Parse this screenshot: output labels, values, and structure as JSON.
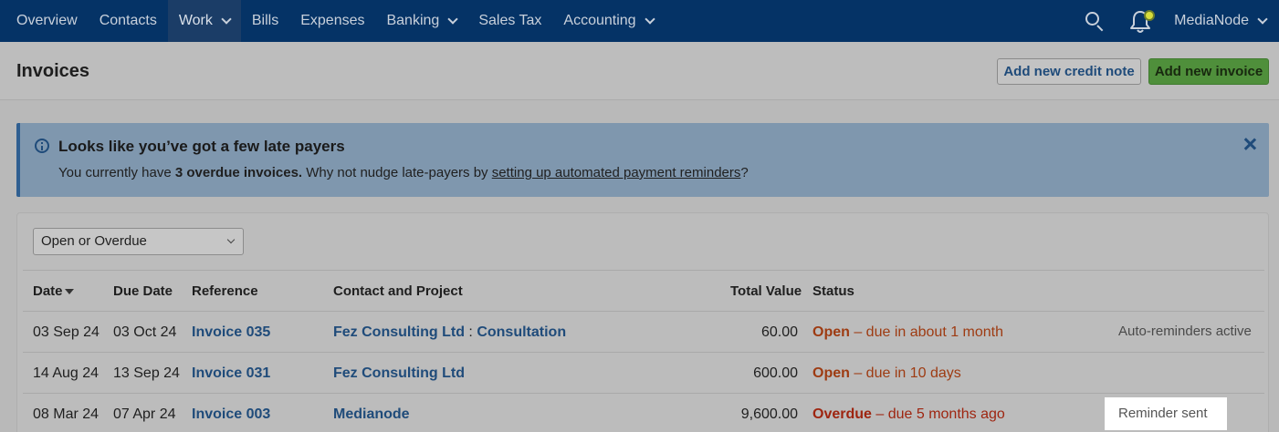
{
  "nav": {
    "items": [
      {
        "label": "Overview",
        "dropdown": false,
        "active": false
      },
      {
        "label": "Contacts",
        "dropdown": false,
        "active": false
      },
      {
        "label": "Work",
        "dropdown": true,
        "active": true
      },
      {
        "label": "Bills",
        "dropdown": false,
        "active": false
      },
      {
        "label": "Expenses",
        "dropdown": false,
        "active": false
      },
      {
        "label": "Banking",
        "dropdown": true,
        "active": false
      },
      {
        "label": "Sales Tax",
        "dropdown": false,
        "active": false
      },
      {
        "label": "Accounting",
        "dropdown": true,
        "active": false
      }
    ],
    "account_label": "MediaNode",
    "colors": {
      "bar": "#053366",
      "active": "#1b3d67"
    }
  },
  "header": {
    "title": "Invoices",
    "credit_note_button": "Add new credit note",
    "new_invoice_button": "Add new invoice"
  },
  "banner": {
    "title": "Looks like you’ve got a few late payers",
    "text_prefix": "You currently have ",
    "text_bold": "3 overdue invoices.",
    "text_middle": " Why not nudge late-payers by ",
    "text_link": "setting up automated payment reminders",
    "text_suffix": "?"
  },
  "filter": {
    "selected": "Open or Overdue"
  },
  "table": {
    "headers": {
      "date": "Date",
      "due_date": "Due Date",
      "reference": "Reference",
      "contact": "Contact and Project",
      "total": "Total Value",
      "status": "Status"
    },
    "rows": [
      {
        "date": "03 Sep 24",
        "due_date": "03 Oct 24",
        "reference": "Invoice 035",
        "contact": "Fez Consulting Ltd",
        "project_sep": " : ",
        "project": "Consultation",
        "total": "60.00",
        "status_word": "Open",
        "status_detail": " – due in about 1 month",
        "note": "Auto-reminders active"
      },
      {
        "date": "14 Aug 24",
        "due_date": "13 Sep 24",
        "reference": "Invoice 031",
        "contact": "Fez Consulting Ltd",
        "project_sep": "",
        "project": "",
        "total": "600.00",
        "status_word": "Open",
        "status_detail": " – due in 10 days",
        "note": ""
      },
      {
        "date": "08 Mar 24",
        "due_date": "07 Apr 24",
        "reference": "Invoice 003",
        "contact": "Medianode",
        "project_sep": "",
        "project": "",
        "total": "9,600.00",
        "status_word": "Overdue",
        "status_detail": " – due 5 months ago",
        "note": "Reminder sent"
      }
    ]
  }
}
